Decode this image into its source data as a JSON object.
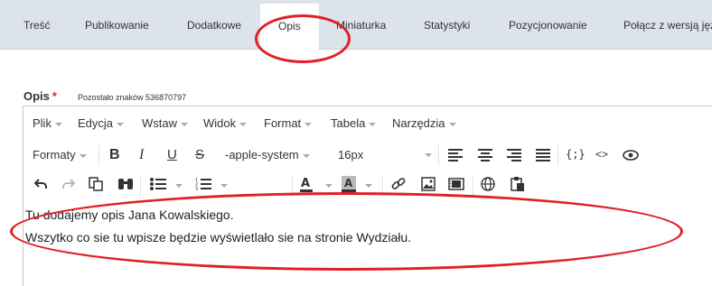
{
  "tabs": [
    {
      "label": "Treść"
    },
    {
      "label": "Publikowanie"
    },
    {
      "label": "Dodatkowe"
    },
    {
      "label": "Opis"
    },
    {
      "label": "Miniaturka"
    },
    {
      "label": "Statystyki"
    },
    {
      "label": "Pozycjonowanie"
    },
    {
      "label": "Połącz z wersją języ"
    }
  ],
  "field": {
    "label": "Opis",
    "required_mark": "*",
    "remaining": "Pozostało znaków 536870797"
  },
  "menu": [
    "Plik",
    "Edycja",
    "Wstaw",
    "Widok",
    "Format",
    "Tabela",
    "Narzędzia"
  ],
  "toolbar": {
    "formats_label": "Formaty",
    "font_family": "-apple-system",
    "font_size": "16px",
    "bold": "B",
    "italic": "I",
    "underline": "U",
    "strike": "S",
    "source_code": "{;}",
    "code_tags": "<>"
  },
  "content": {
    "line1": "Tu dodajemy opis Jana Kowalskiego.",
    "line2": "Wszytko co sie tu wpisze będzie wyświetlało sie na stronie Wydziału."
  },
  "colors": {
    "annotation": "#e11f26",
    "tabbar": "#dde3ea"
  }
}
